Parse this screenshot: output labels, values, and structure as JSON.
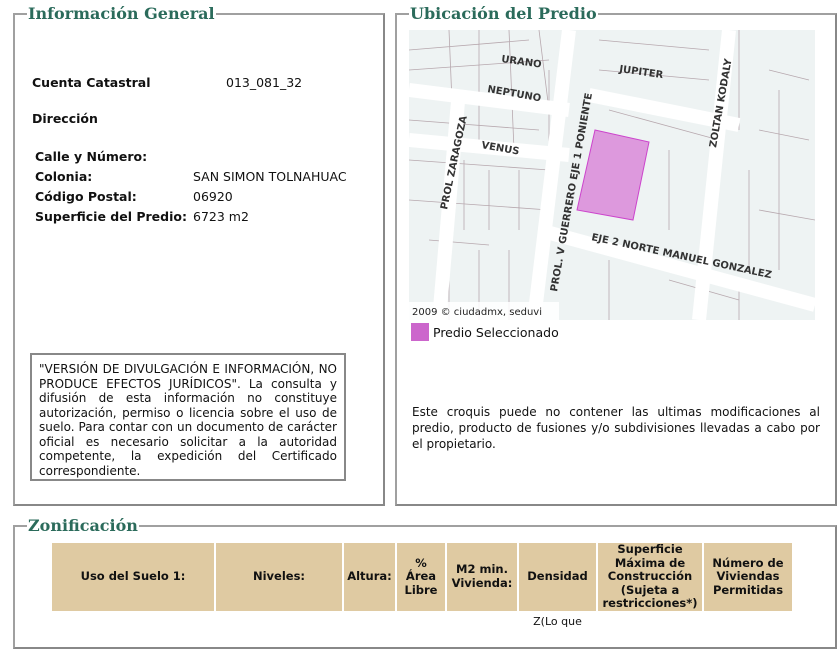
{
  "info": {
    "title": "Información General",
    "cuenta_label": "Cuenta Catastral",
    "cuenta_value": "013_081_32",
    "direccion_label": "Dirección",
    "calle_label": "Calle y Número:",
    "calle_value": "",
    "colonia_label": "Colonia:",
    "colonia_value": "SAN SIMON TOLNAHUAC",
    "cp_label": "Código Postal:",
    "cp_value": "06920",
    "superficie_label": "Superficie del Predio:",
    "superficie_value": "6723 m2",
    "disclaimer": "\"VERSIÓN DE DIVULGACIÓN E INFORMACIÓN, NO PRODUCE EFECTOS JURÍDICOS\". La consulta y difusión de esta información no constituye autorización, permiso o licencia sobre el uso de suelo. Para contar con un documento de carácter oficial es necesario solicitar a la autoridad competente, la expedición del Certificado correspondiente."
  },
  "ubicacion": {
    "title": "Ubicación del Predio",
    "streets": [
      "URANO",
      "NEPTUNO",
      "JUPITER",
      "VENUS",
      "PROL ZARAGOZA",
      "PROL. V GUERRERO EJE 1 PONIENTE",
      "ZOLTAN KODALY",
      "EJE 2 NORTE MANUEL GONZALEZ"
    ],
    "copyright": "2009 © ciudadmx, seduvi",
    "legend_label": "Predio Seleccionado",
    "legend_color": "#cc66cc",
    "note": "Este croquis puede no contener las ultimas modificaciones al predio, producto de fusiones y/o subdivisiones llevadas a cabo por el propietario."
  },
  "zonificacion": {
    "title": "Zonificación",
    "headers": [
      "Uso del Suelo 1:",
      "Niveles:",
      "Altura:",
      "% Área Libre",
      "M2 min. Vivienda:",
      "Densidad",
      "Superficie Máxima de Construcción (Sujeta a restricciones*)",
      "Número de Viviendas Permitidas"
    ],
    "row_partial": "Z(Lo que"
  }
}
